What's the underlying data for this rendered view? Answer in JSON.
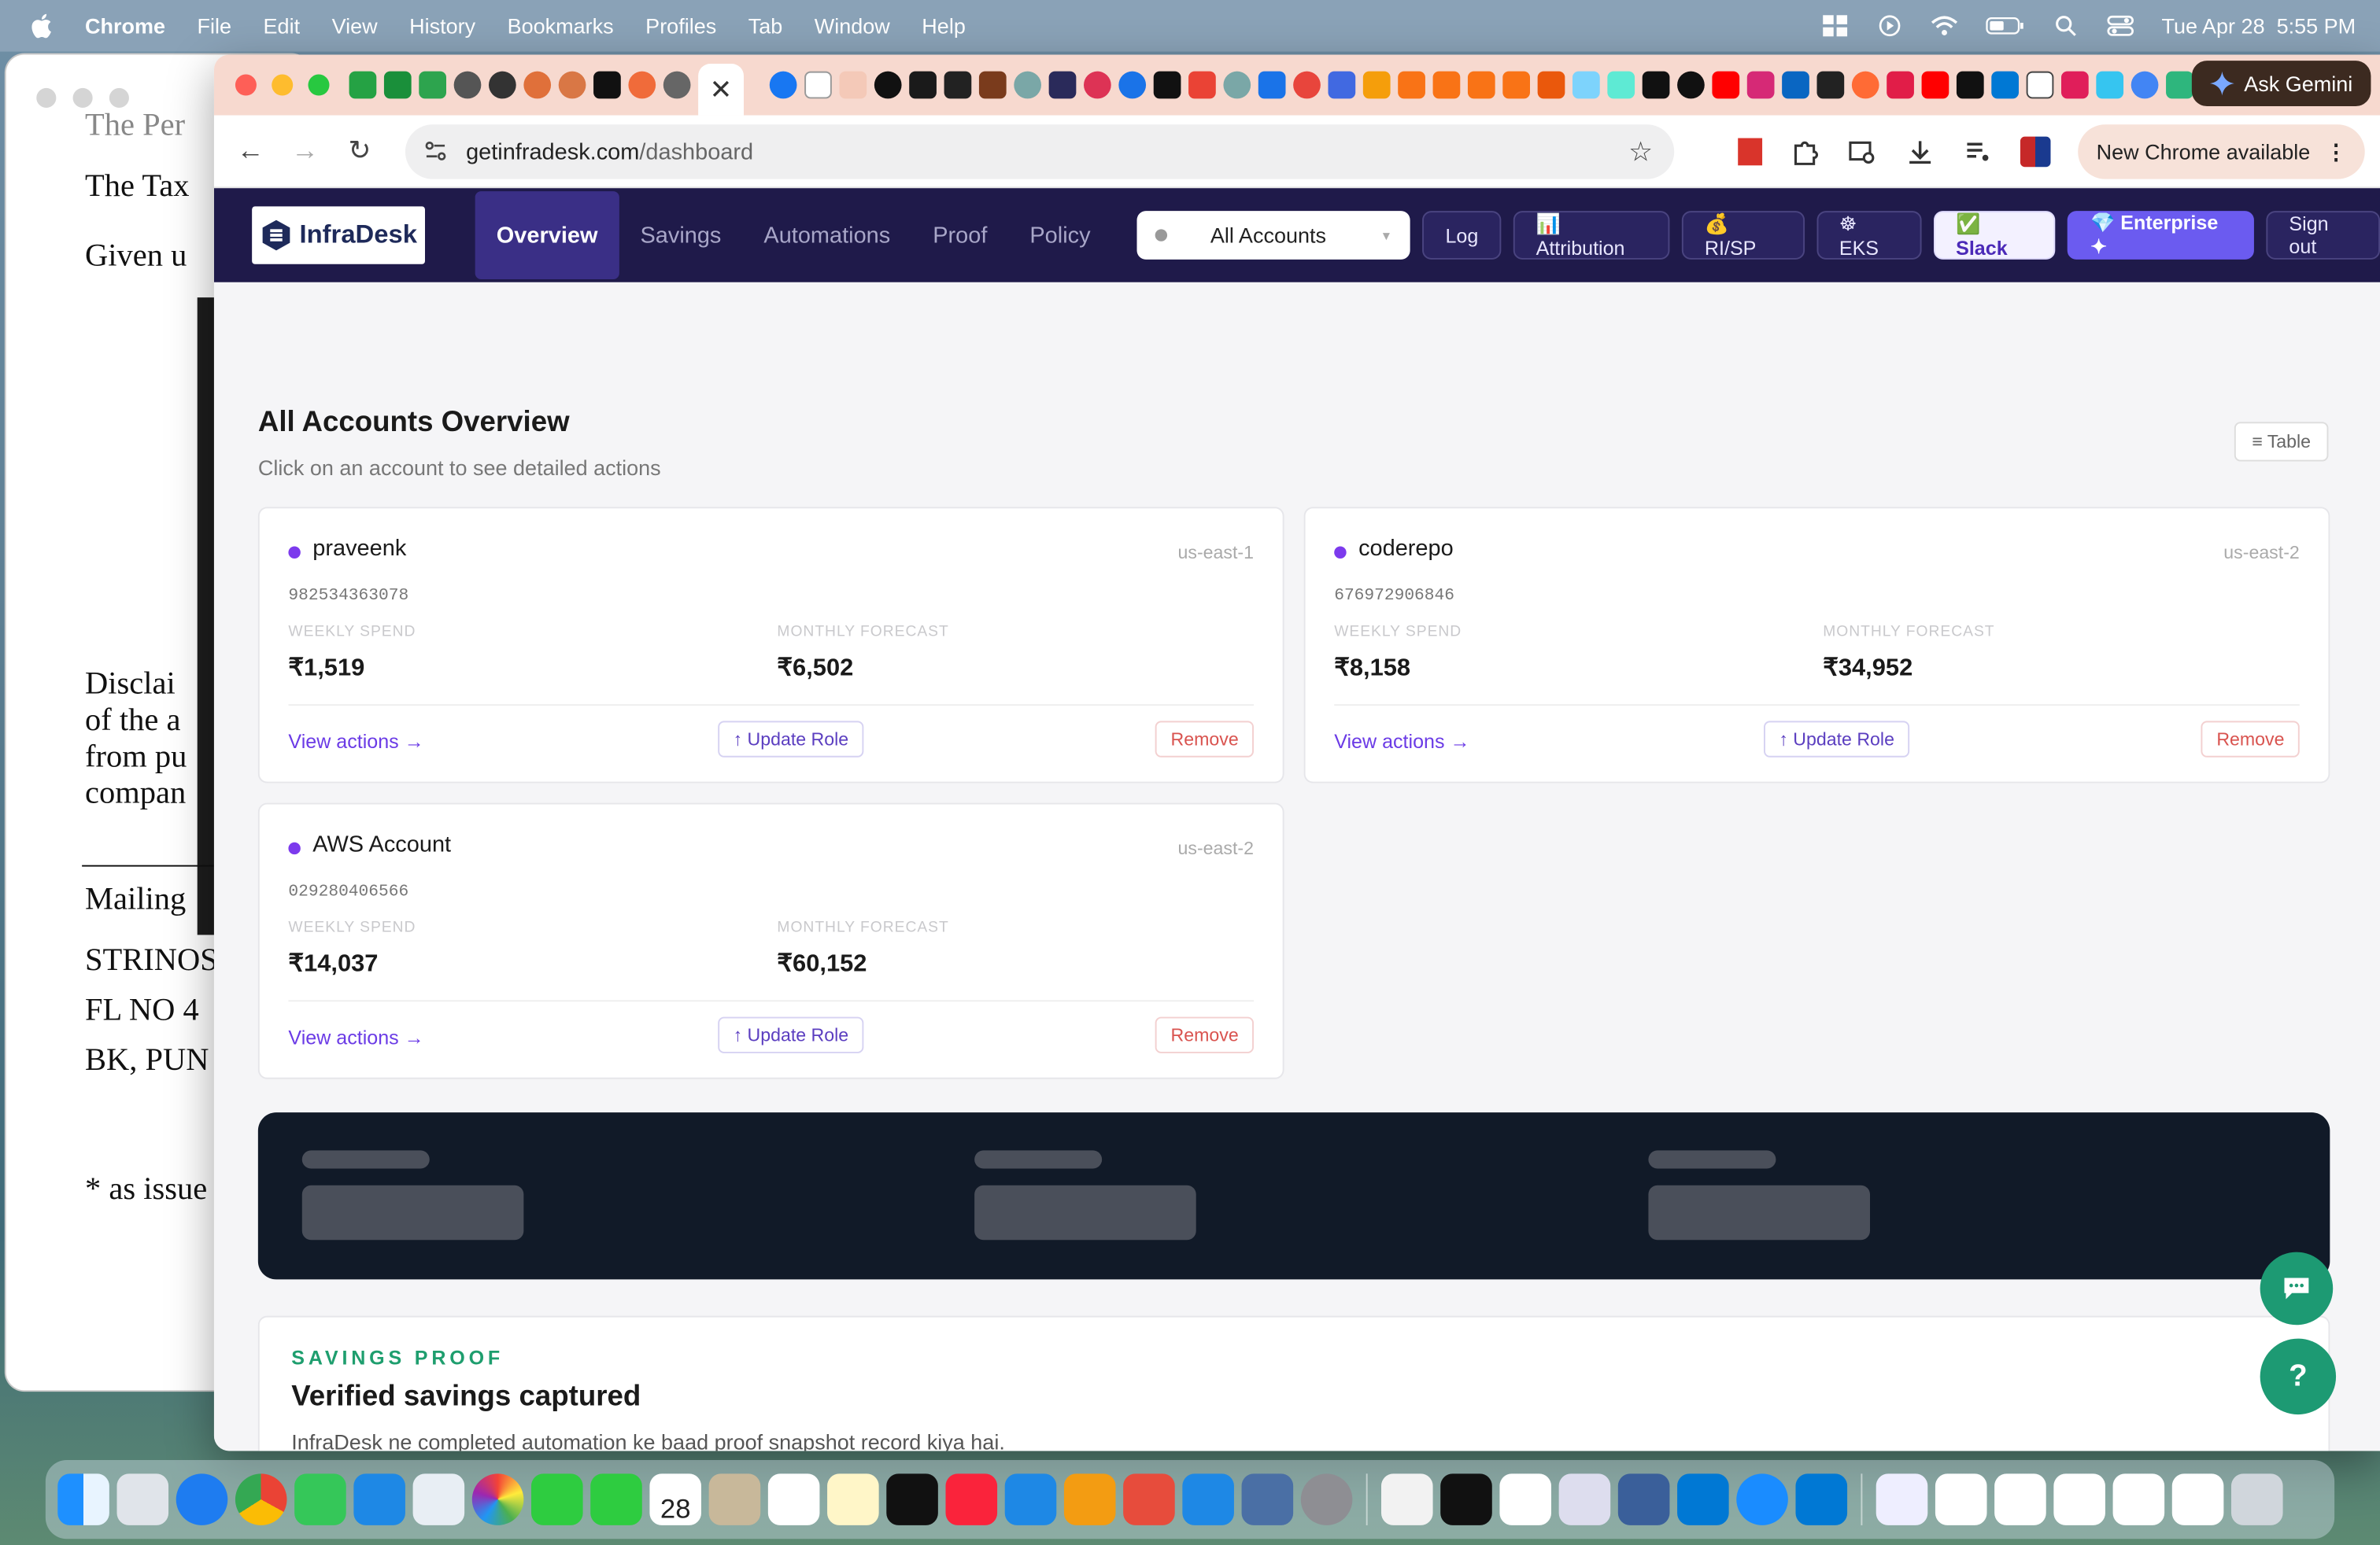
{
  "menubar": {
    "app_name": "Chrome",
    "menus": [
      "File",
      "Edit",
      "View",
      "History",
      "Bookmarks",
      "Profiles",
      "Tab",
      "Window",
      "Help"
    ],
    "clock": "Tue Apr 28  5:55 PM"
  },
  "background_doc": {
    "lines": [
      "The Per",
      "The Tax",
      "Given u",
      "Disclai",
      "of the a",
      "from pu",
      "compan",
      "Mailing",
      "STRINOS",
      "FL NO 4",
      "BK, PUN",
      "* as issue"
    ]
  },
  "browser": {
    "gemini_label": "Ask Gemini",
    "url_host": "getinfradesk.com",
    "url_path": "/dashboard",
    "update_label": "New Chrome available",
    "new_tab": "+"
  },
  "app": {
    "logo": "InfraDesk",
    "nav": [
      "Overview",
      "Savings",
      "Automations",
      "Proof",
      "Policy"
    ],
    "account_selector": "All Accounts",
    "buttons": {
      "log": "Log",
      "attribution": "📊 Attribution",
      "risp": "💰 RI/SP",
      "eks": "☸ EKS",
      "slack": "✅ Slack",
      "enterprise": "💎 Enterprise ✦",
      "signout": "Sign out"
    },
    "overview": {
      "title": "All Accounts Overview",
      "subtitle": "Click on an account to see detailed actions",
      "table_toggle": "≡ Table"
    },
    "cards_labels": {
      "weekly": "WEEKLY SPEND",
      "monthly": "MONTHLY FORECAST",
      "view": "View actions →",
      "update": "↑ Update Role",
      "remove": "Remove"
    },
    "accounts": [
      {
        "name": "praveenk",
        "region": "us-east-1",
        "id": "982534363078",
        "weekly": "₹1,519",
        "monthly": "₹6,502"
      },
      {
        "name": "coderepo",
        "region": "us-east-2",
        "id": "676972906846",
        "weekly": "₹8,158",
        "monthly": "₹34,952"
      },
      {
        "name": "AWS Account",
        "region": "us-east-2",
        "id": "029280406566",
        "weekly": "₹14,037",
        "monthly": "₹60,152"
      }
    ],
    "proof": {
      "kicker": "SAVINGS PROOF",
      "heading": "Verified savings captured",
      "text": "InfraDesk ne completed automation ke baad proof snapshot record kiya hai."
    },
    "fab_help": "?"
  },
  "dock": {
    "calendar_day": "28"
  }
}
